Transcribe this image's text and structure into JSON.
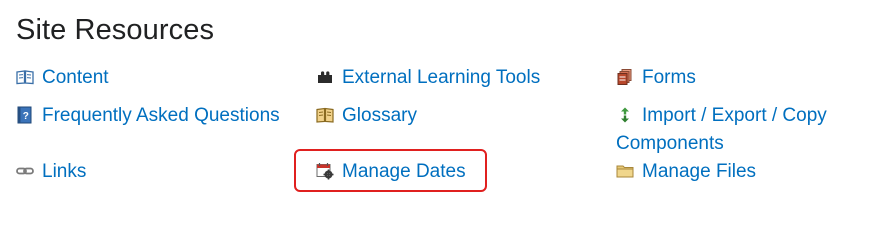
{
  "section": {
    "title": "Site Resources"
  },
  "links": [
    {
      "label": "Content",
      "icon": "book-icon"
    },
    {
      "label": "External Learning Tools",
      "icon": "puzzle-icon"
    },
    {
      "label": "Forms",
      "icon": "forms-icon"
    },
    {
      "label": "Frequently Asked Questions",
      "icon": "faq-icon"
    },
    {
      "label": "Glossary",
      "icon": "glossary-book-icon"
    },
    {
      "label": "Import / Export / Copy Components",
      "icon": "import-export-icon"
    },
    {
      "label": "Links",
      "icon": "link-icon"
    },
    {
      "label": "Manage Dates",
      "icon": "calendar-gear-icon"
    },
    {
      "label": "Manage Files",
      "icon": "folder-icon"
    }
  ],
  "colors": {
    "link": "#006fbf",
    "title": "#202122",
    "highlight_border": "#e0201f"
  }
}
